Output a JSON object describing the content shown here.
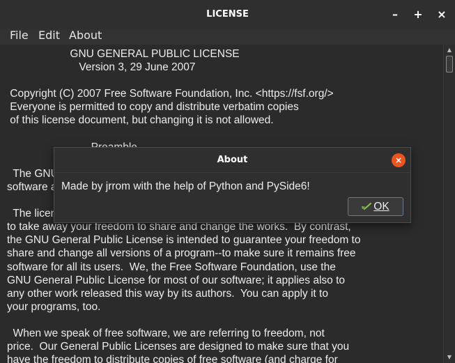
{
  "window": {
    "title": "LICENSE",
    "controls": {
      "minimize": "–",
      "maximize": "+",
      "close": "×"
    }
  },
  "menubar": {
    "items": [
      "File",
      "Edit",
      "About"
    ]
  },
  "document": {
    "lines": [
      "                     GNU GENERAL PUBLIC LICENSE",
      "                        Version 3, 29 June 2007",
      "",
      " Copyright (C) 2007 Free Software Foundation, Inc. <https://fsf.org/>",
      " Everyone is permitted to copy and distribute verbatim copies",
      " of this license document, but changing it is not allowed.",
      "",
      "                            Preamble",
      "",
      "  The GNU General Public License is a free, copyleft license for",
      "software and other kinds of works.",
      "",
      "  The licenses for most software and other practical works are designed",
      "to take away your freedom to share and change the works.  By contrast,",
      "the GNU General Public License is intended to guarantee your freedom to",
      "share and change all versions of a program--to make sure it remains free",
      "software for all its users.  We, the Free Software Foundation, use the",
      "GNU General Public License for most of our software; it applies also to",
      "any other work released this way by its authors.  You can apply it to",
      "your programs, too.",
      "",
      "  When we speak of free software, we are referring to freedom, not",
      "price.  Our General Public Licenses are designed to make sure that you",
      "have the freedom to distribute copies of free software (and charge for"
    ]
  },
  "dialog": {
    "title": "About",
    "close_glyph": "×",
    "message": "Made by jrrom with the help of Python and PySide6!",
    "ok_label": "OK"
  },
  "icons": {
    "dialog_close": "close-icon",
    "ok": "checkmark-icon",
    "scroll_up": "arrow-up-icon",
    "scroll_down": "arrow-down-icon"
  },
  "colors": {
    "background": "#2b2b2b",
    "titlebar": "#2f2f2f",
    "text": "#ececec",
    "accent_close": "#e95420",
    "ok_border": "#6a7b8f"
  }
}
